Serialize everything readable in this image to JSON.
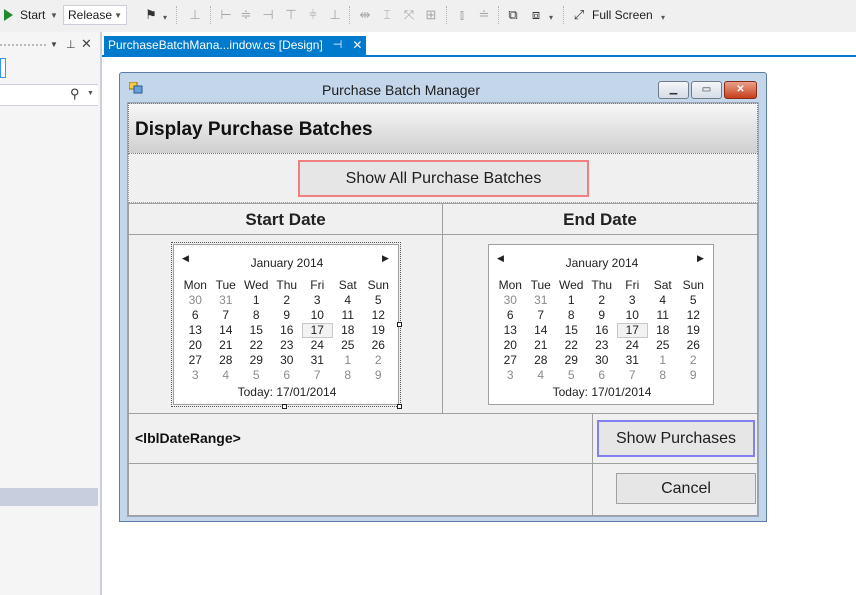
{
  "toolbar": {
    "start_label": "Start",
    "config_value": "Release",
    "fullscreen_label": "Full Screen"
  },
  "document_tab": {
    "title": "PurchaseBatchMana...indow.cs [Design]",
    "pin_glyph": "⊣",
    "close_glyph": "✕"
  },
  "form": {
    "title": "Purchase Batch Manager",
    "header": "Display Purchase Batches",
    "show_all_button": "Show All Purchase Batches",
    "start_date_header": "Start Date",
    "end_date_header": "End Date",
    "date_range_label": "<lblDateRange>",
    "show_purchases_button": "Show Purchases",
    "cancel_button": "Cancel"
  },
  "calendar": {
    "month": "January 2014",
    "weekdays": [
      "Mon",
      "Tue",
      "Wed",
      "Thu",
      "Fri",
      "Sat",
      "Sun"
    ],
    "weeks": [
      [
        "30",
        "31",
        "1",
        "2",
        "3",
        "4",
        "5"
      ],
      [
        "6",
        "7",
        "8",
        "9",
        "10",
        "11",
        "12"
      ],
      [
        "13",
        "14",
        "15",
        "16",
        "17",
        "18",
        "19"
      ],
      [
        "20",
        "21",
        "22",
        "23",
        "24",
        "25",
        "26"
      ],
      [
        "27",
        "28",
        "29",
        "30",
        "31",
        "1",
        "2"
      ],
      [
        "3",
        "4",
        "5",
        "6",
        "7",
        "8",
        "9"
      ]
    ],
    "today_label": "Today: 17/01/2014"
  },
  "colors": {
    "accent": "#007acc",
    "show_all_border": "#f08080",
    "show_purchases_border": "#8080f0"
  }
}
